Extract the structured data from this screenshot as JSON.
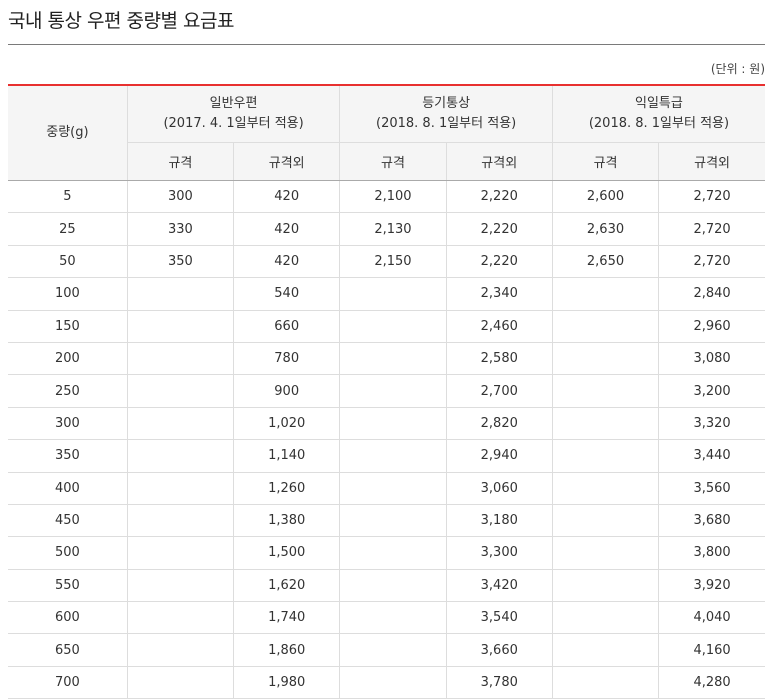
{
  "title": "국내 통상 우편 중량별 요금표",
  "unit": "(단위 : 원)",
  "table": {
    "weight_header": "중량(g)",
    "groups": [
      {
        "name": "일반우편",
        "note": "(2017. 4. 1일부터 적용)"
      },
      {
        "name": "등기통상",
        "note": "(2018. 8. 1일부터 적용)"
      },
      {
        "name": "익일특급",
        "note": "(2018. 8. 1일부터 적용)"
      }
    ],
    "sub_headers": [
      "규격",
      "규격외",
      "규격",
      "규격외",
      "규격",
      "규격외"
    ],
    "rows": [
      [
        "5",
        "300",
        "420",
        "2,100",
        "2,220",
        "2,600",
        "2,720"
      ],
      [
        "25",
        "330",
        "420",
        "2,130",
        "2,220",
        "2,630",
        "2,720"
      ],
      [
        "50",
        "350",
        "420",
        "2,150",
        "2,220",
        "2,650",
        "2,720"
      ],
      [
        "100",
        "",
        "540",
        "",
        "2,340",
        "",
        "2,840"
      ],
      [
        "150",
        "",
        "660",
        "",
        "2,460",
        "",
        "2,960"
      ],
      [
        "200",
        "",
        "780",
        "",
        "2,580",
        "",
        "3,080"
      ],
      [
        "250",
        "",
        "900",
        "",
        "2,700",
        "",
        "3,200"
      ],
      [
        "300",
        "",
        "1,020",
        "",
        "2,820",
        "",
        "3,320"
      ],
      [
        "350",
        "",
        "1,140",
        "",
        "2,940",
        "",
        "3,440"
      ],
      [
        "400",
        "",
        "1,260",
        "",
        "3,060",
        "",
        "3,560"
      ],
      [
        "450",
        "",
        "1,380",
        "",
        "3,180",
        "",
        "3,680"
      ],
      [
        "500",
        "",
        "1,500",
        "",
        "3,300",
        "",
        "3,800"
      ],
      [
        "550",
        "",
        "1,620",
        "",
        "3,420",
        "",
        "3,920"
      ],
      [
        "600",
        "",
        "1,740",
        "",
        "3,540",
        "",
        "4,040"
      ],
      [
        "650",
        "",
        "1,860",
        "",
        "3,660",
        "",
        "4,160"
      ],
      [
        "700",
        "",
        "1,980",
        "",
        "3,780",
        "",
        "4,280"
      ]
    ]
  }
}
